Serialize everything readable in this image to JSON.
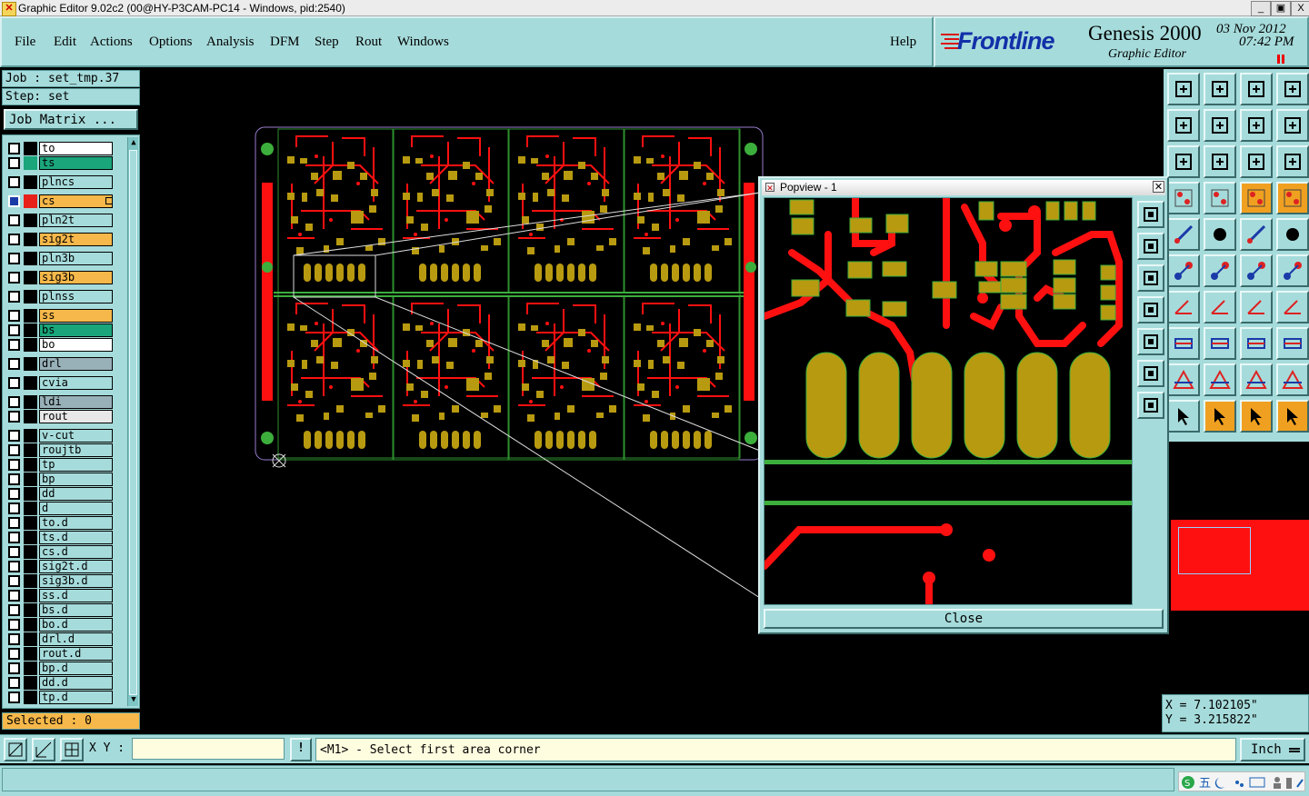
{
  "window": {
    "title": "Graphic Editor 9.02c2 (00@HY-P3CAM-PC14 - Windows, pid:2540)",
    "buttons": [
      "_",
      "▣",
      "X"
    ]
  },
  "menu": [
    "File",
    "Edit",
    "Actions",
    "Options",
    "Analysis",
    "DFM",
    "Step",
    "Rout",
    "Windows"
  ],
  "help": "Help",
  "brand": {
    "logo": "Frontline",
    "product": "Genesis 2000",
    "subtitle": "Graphic Editor",
    "date": "03 Nov 2012",
    "time": "07:42 PM"
  },
  "job": {
    "job_line": "Job : set_tmp.37",
    "step_line": "Step: set",
    "matrix_button": "Job Matrix ..."
  },
  "layers": [
    {
      "name": "to",
      "bg": "#ffffff",
      "swatch": "#000000"
    },
    {
      "name": "ts",
      "bg": "#1aa57a",
      "swatch": "#1aa57a"
    },
    {
      "name": "plncs",
      "bg": "#a6dbdb",
      "swatch": "#000000"
    },
    {
      "name": "cs",
      "bg": "#f6b84a",
      "swatch": "#e8201a",
      "active": true
    },
    {
      "name": "pln2t",
      "bg": "#a6dbdb",
      "swatch": "#000000"
    },
    {
      "name": "sig2t",
      "bg": "#f6b84a",
      "swatch": "#000000"
    },
    {
      "name": "pln3b",
      "bg": "#a6dbdb",
      "swatch": "#000000"
    },
    {
      "name": "sig3b",
      "bg": "#f6b84a",
      "swatch": "#000000"
    },
    {
      "name": "plnss",
      "bg": "#a6dbdb",
      "swatch": "#000000"
    },
    {
      "name": "ss",
      "bg": "#f6b84a",
      "swatch": "#000000"
    },
    {
      "name": "bs",
      "bg": "#1aa57a",
      "swatch": "#000000"
    },
    {
      "name": "bo",
      "bg": "#ffffff",
      "swatch": "#000000"
    },
    {
      "name": "drl",
      "bg": "#98b0b8",
      "swatch": "#000000"
    },
    {
      "name": "cvia",
      "bg": "#a6dbdb",
      "swatch": "#000000"
    },
    {
      "name": "ldi",
      "bg": "#98b0b8",
      "swatch": "#000000"
    },
    {
      "name": "rout",
      "bg": "#e8e8e8",
      "swatch": "#000000"
    },
    {
      "name": "v-cut",
      "bg": "#a6dbdb",
      "swatch": "#000000"
    },
    {
      "name": "roujtb",
      "bg": "#a6dbdb",
      "swatch": "#000000"
    },
    {
      "name": "tp",
      "bg": "#a6dbdb",
      "swatch": "#000000"
    },
    {
      "name": "bp",
      "bg": "#a6dbdb",
      "swatch": "#000000"
    },
    {
      "name": "dd",
      "bg": "#a6dbdb",
      "swatch": "#000000"
    },
    {
      "name": "d",
      "bg": "#a6dbdb",
      "swatch": "#000000"
    },
    {
      "name": "to.d",
      "bg": "#a6dbdb",
      "swatch": "#000000"
    },
    {
      "name": "ts.d",
      "bg": "#a6dbdb",
      "swatch": "#000000"
    },
    {
      "name": "cs.d",
      "bg": "#a6dbdb",
      "swatch": "#000000"
    },
    {
      "name": "sig2t.d",
      "bg": "#a6dbdb",
      "swatch": "#000000"
    },
    {
      "name": "sig3b.d",
      "bg": "#a6dbdb",
      "swatch": "#000000"
    },
    {
      "name": "ss.d",
      "bg": "#a6dbdb",
      "swatch": "#000000"
    },
    {
      "name": "bs.d",
      "bg": "#a6dbdb",
      "swatch": "#000000"
    },
    {
      "name": "bo.d",
      "bg": "#a6dbdb",
      "swatch": "#000000"
    },
    {
      "name": "drl.d",
      "bg": "#a6dbdb",
      "swatch": "#000000"
    },
    {
      "name": "rout.d",
      "bg": "#a6dbdb",
      "swatch": "#000000"
    },
    {
      "name": "bp.d",
      "bg": "#a6dbdb",
      "swatch": "#000000"
    },
    {
      "name": "dd.d",
      "bg": "#a6dbdb",
      "swatch": "#000000"
    },
    {
      "name": "tp.d",
      "bg": "#a6dbdb",
      "swatch": "#000000"
    }
  ],
  "selected": "Selected : 0",
  "popview": {
    "title": "Popview - 1",
    "close_button": "Close"
  },
  "coords": {
    "x": "X = 7.102105\"",
    "y": "Y = 3.215822\""
  },
  "bottom": {
    "xy_label": "X Y :",
    "xy_value": "",
    "bang": "!",
    "prompt": "<M1> - Select first area corner",
    "units": "Inch"
  },
  "colors": {
    "panel": "#a6dbdb",
    "copper": "#b89a10",
    "trace": "#ff1010",
    "outline": "#3cae3c"
  }
}
